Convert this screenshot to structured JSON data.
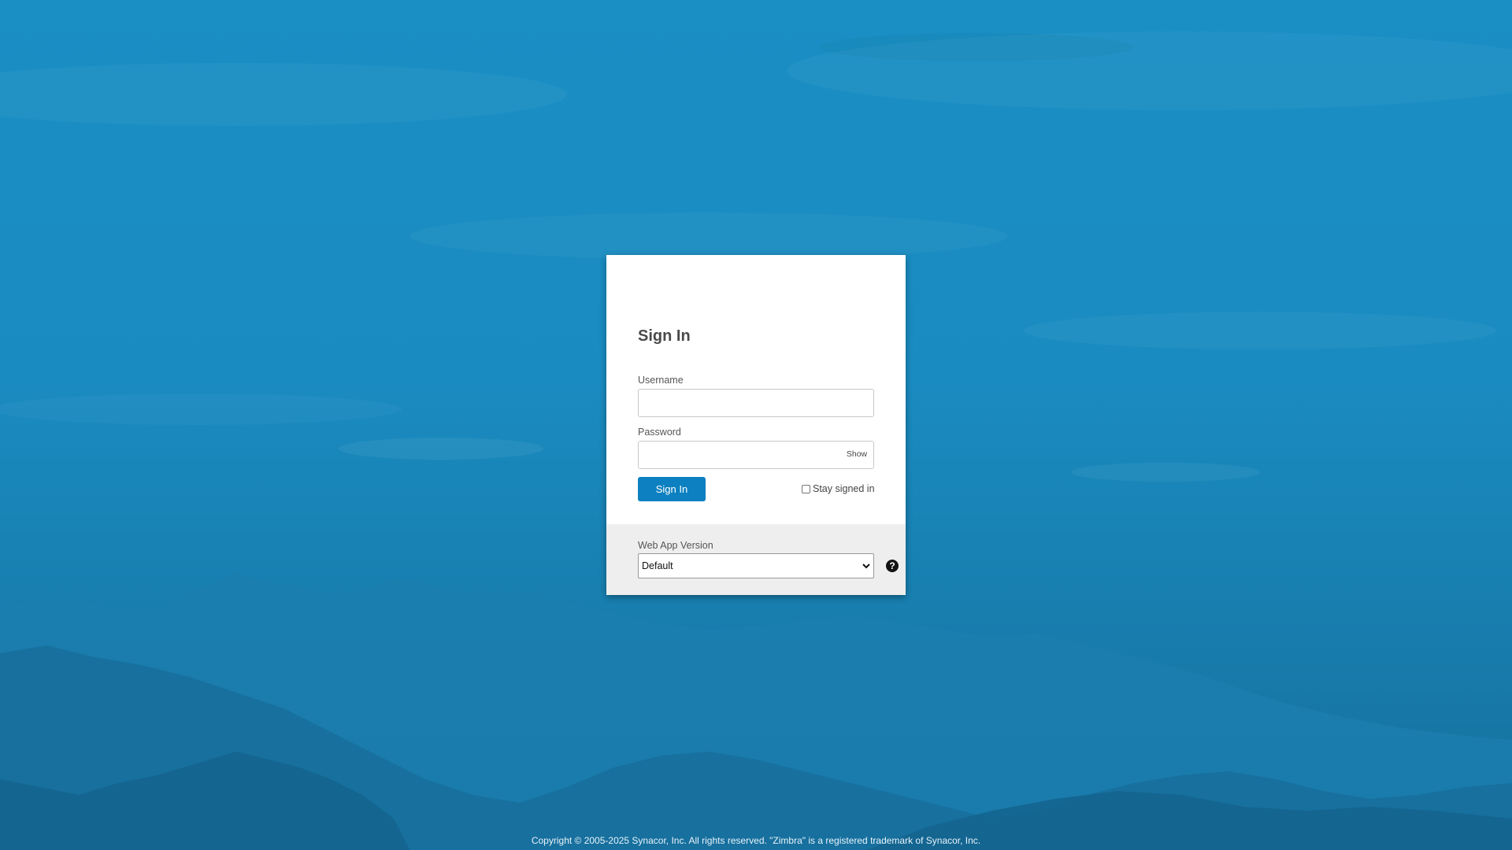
{
  "theme": {
    "accent": "#0c80c0",
    "background": "#1a8bc0"
  },
  "login": {
    "title": "Sign In",
    "username_label": "Username",
    "username_value": "",
    "password_label": "Password",
    "password_value": "",
    "show_label": "Show",
    "signin_label": "Sign In",
    "stay_signed_in_label": "Stay signed in",
    "stay_signed_in_checked": false
  },
  "version": {
    "label": "Web App Version",
    "selected": "Default",
    "help_icon": "help-icon",
    "help_glyph": "?"
  },
  "footer": {
    "copyright": "Copyright © 2005-2025 Synacor, Inc. All rights reserved. \"Zimbra\" is a registered trademark of Synacor, Inc."
  }
}
